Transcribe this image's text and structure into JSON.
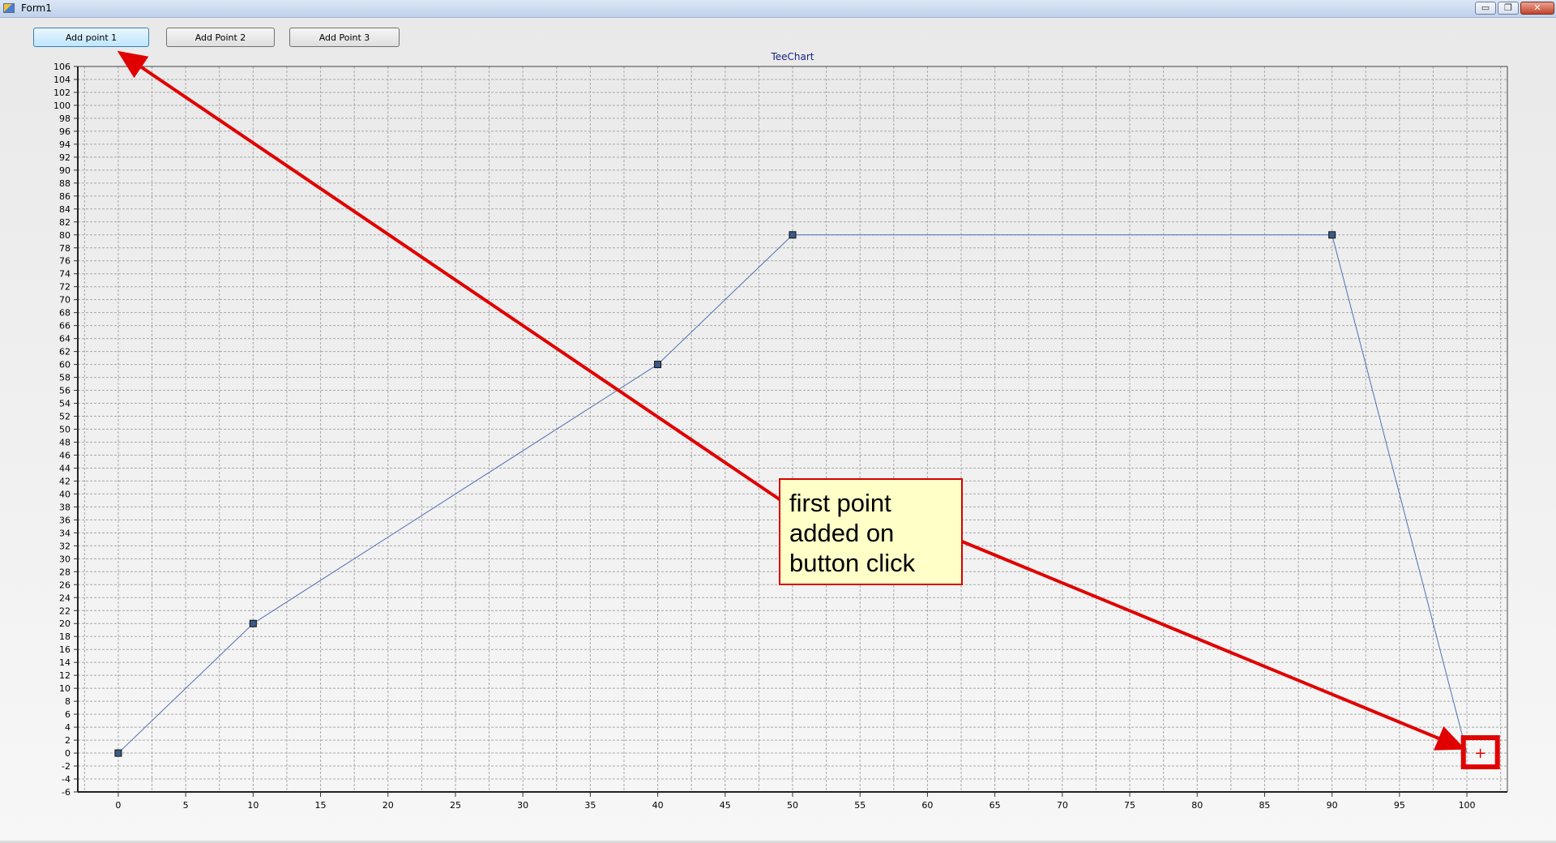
{
  "window": {
    "title": "Form1",
    "controls": {
      "minimize": "▭",
      "maximize": "❐",
      "close": "✕"
    }
  },
  "buttons": {
    "add_point_1": "Add point 1",
    "add_point_2": "Add Point 2",
    "add_point_3": "Add Point 3"
  },
  "annotation": {
    "callout_lines": [
      "first point",
      "added on",
      "button click"
    ],
    "marker_glyph": "+",
    "color": "#e00000",
    "callout_fill": "#ffffc8"
  },
  "chart_data": {
    "type": "line",
    "title": "TeeChart",
    "xlabel": "",
    "ylabel": "",
    "xlim": [
      -3,
      103
    ],
    "ylim": [
      -6,
      106
    ],
    "x_ticks": [
      0,
      5,
      10,
      15,
      20,
      25,
      30,
      35,
      40,
      45,
      50,
      55,
      60,
      65,
      70,
      75,
      80,
      85,
      90,
      95,
      100
    ],
    "y_tick_step": 2,
    "grid": true,
    "legend": "none",
    "line_color": "#5070b0",
    "marker": "square",
    "series": [
      {
        "points": [
          {
            "x": 0,
            "y": 0
          },
          {
            "x": 10,
            "y": 20
          },
          {
            "x": 40,
            "y": 60
          },
          {
            "x": 50,
            "y": 80
          },
          {
            "x": 90,
            "y": 80
          },
          {
            "x": 100,
            "y": 0
          }
        ],
        "markers_on": [
          0,
          1,
          2,
          3,
          4
        ]
      }
    ],
    "highlighted_point": {
      "x": 101,
      "y": 0
    }
  }
}
